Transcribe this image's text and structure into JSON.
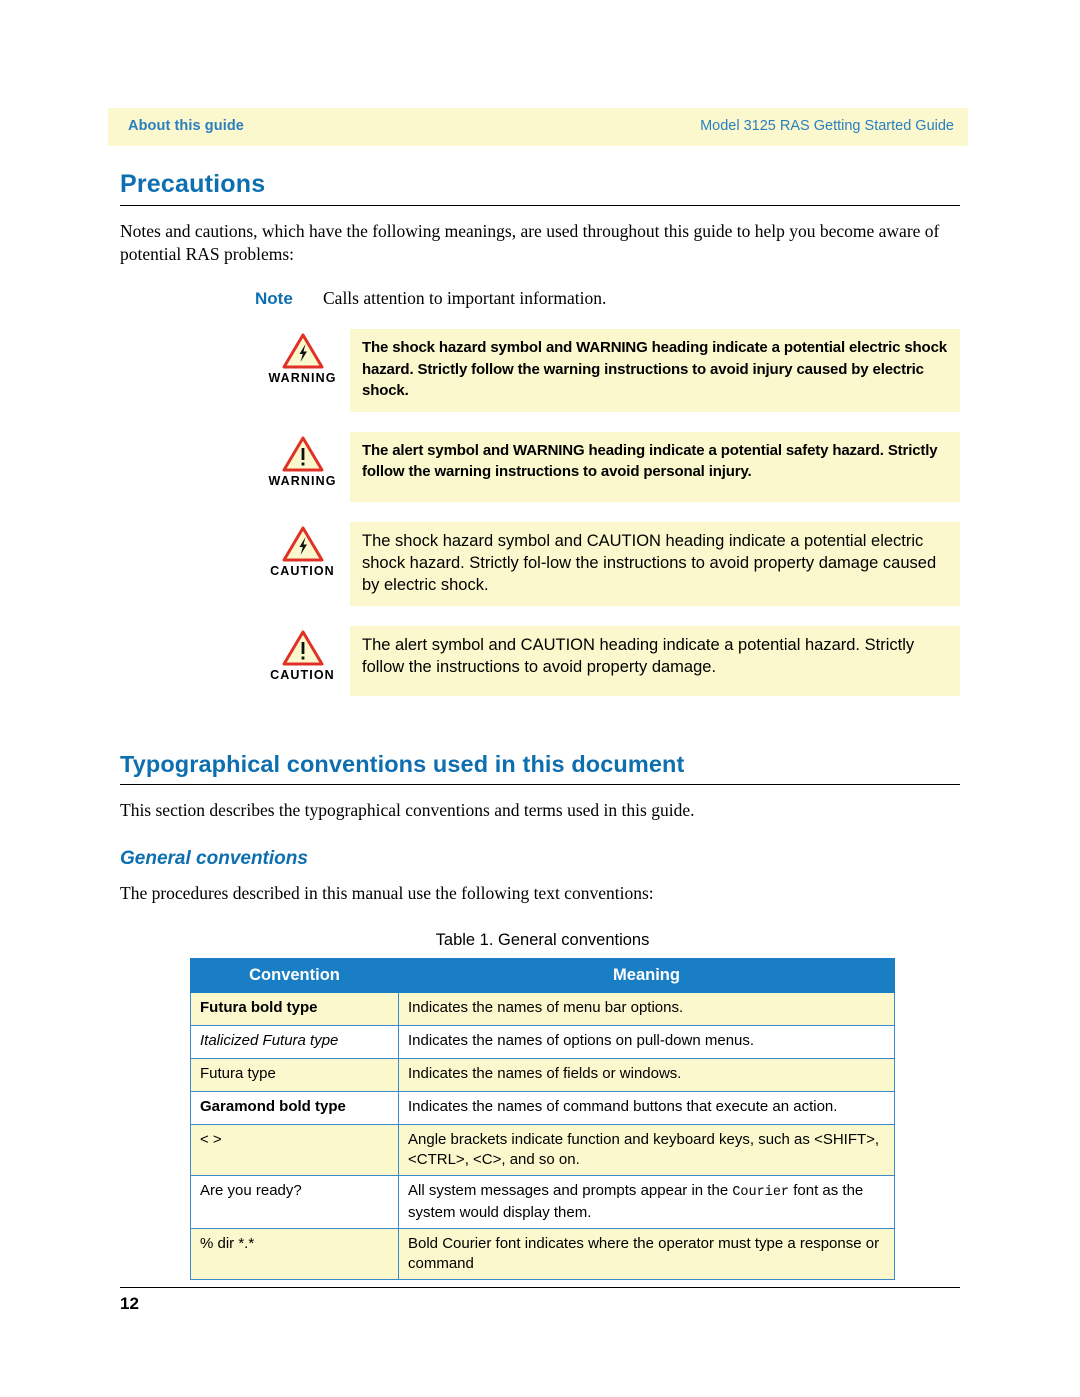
{
  "header": {
    "left": "About this guide",
    "right": "Model 3125 RAS Getting Started Guide"
  },
  "colors": {
    "heading_blue": "#0e6fb0",
    "header_blue": "#2a7fc1",
    "band_yellow": "#fbf8cd",
    "table_header_blue": "#1a7ec4",
    "table_border_blue": "#3c89c9",
    "caution_red": "#e03127"
  },
  "precautions": {
    "title": "Precautions",
    "intro": "Notes and cautions, which have the following meanings, are used throughout this guide to help you become aware of potential RAS problems:",
    "note": {
      "label": "Note",
      "text": "Calls attention to important information."
    },
    "admonitions": [
      {
        "label": "WARNING",
        "icon": "shock-hazard-icon",
        "text": "The shock hazard symbol and WARNING heading indicate a potential electric shock hazard. Strictly follow the warning instructions to avoid injury caused by electric shock."
      },
      {
        "label": "WARNING",
        "icon": "alert-icon",
        "text": "The alert symbol and WARNING heading indicate a potential safety hazard. Strictly follow the warning instructions to avoid personal injury."
      },
      {
        "label": "CAUTION",
        "icon": "shock-hazard-icon",
        "text": "The shock hazard symbol and CAUTION heading indicate a potential electric shock hazard. Strictly fol-low the instructions to avoid property damage caused by electric shock."
      },
      {
        "label": "CAUTION",
        "icon": "alert-icon",
        "text": "The alert symbol and CAUTION heading indicate a potential hazard. Strictly follow the instructions to avoid property damage."
      }
    ]
  },
  "typographical": {
    "title": "Typographical conventions used in this document",
    "intro": "This section describes the typographical conventions and terms used in this guide.",
    "subtitle": "General conventions",
    "sub_intro": "The procedures described in this manual use the following text conventions:",
    "table_caption": "Table 1. General conventions",
    "table": {
      "headers": [
        "Convention",
        "Meaning"
      ],
      "rows": [
        {
          "convention": "Futura bold type",
          "meaning": "Indicates the names of menu bar options."
        },
        {
          "convention": "Italicized Futura type",
          "meaning": "Indicates the names of options on pull-down menus."
        },
        {
          "convention": "Futura type",
          "meaning": "Indicates the names of fields or windows."
        },
        {
          "convention": "Garamond bold type",
          "meaning": "Indicates the names of command buttons that execute an action."
        },
        {
          "convention": "< >",
          "meaning": "Angle brackets indicate function and keyboard keys, such as <SHIFT>, <CTRL>, <C>, and so on."
        },
        {
          "convention": "Are you ready?",
          "meaning_pre": "All system messages and prompts appear in the ",
          "meaning_mono": "Courier",
          "meaning_post": " font as the system would display them."
        },
        {
          "convention": "% dir *.*",
          "meaning": "Bold Courier font indicates where the operator must type a response or command"
        }
      ]
    }
  },
  "footer": {
    "page_number": "12"
  }
}
